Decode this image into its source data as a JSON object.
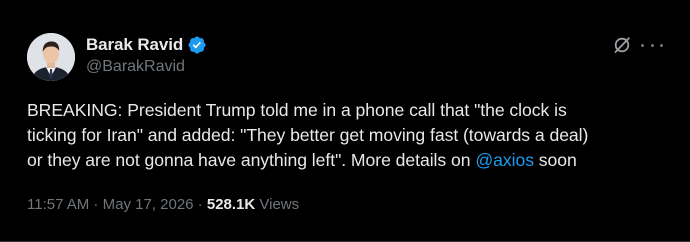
{
  "author": {
    "name": "Barak Ravid",
    "handle": "@BarakRavid",
    "verified_color": "#1d9bf0"
  },
  "actions": {
    "grok_icon": "grok-slash-icon",
    "more_icon": "more-dots-icon"
  },
  "tweet": {
    "line1": "BREAKING: President Trump told me in a phone call that \"the clock is",
    "line2": "ticking for Iran\" and added: \"They better get moving fast (towards a deal)",
    "line3_before": "or they are not gonna have anything left\". More details on ",
    "mention": "@axios",
    "line3_after": " soon"
  },
  "meta": {
    "time": "11:57 AM",
    "sep1": " · ",
    "date": "May 17, 2026",
    "sep2": " · ",
    "views_count": "528.1K",
    "views_label": " Views"
  },
  "colors": {
    "background": "#000000",
    "text": "#e7e9ea",
    "secondary": "#71767b",
    "accent": "#1d9bf0"
  }
}
